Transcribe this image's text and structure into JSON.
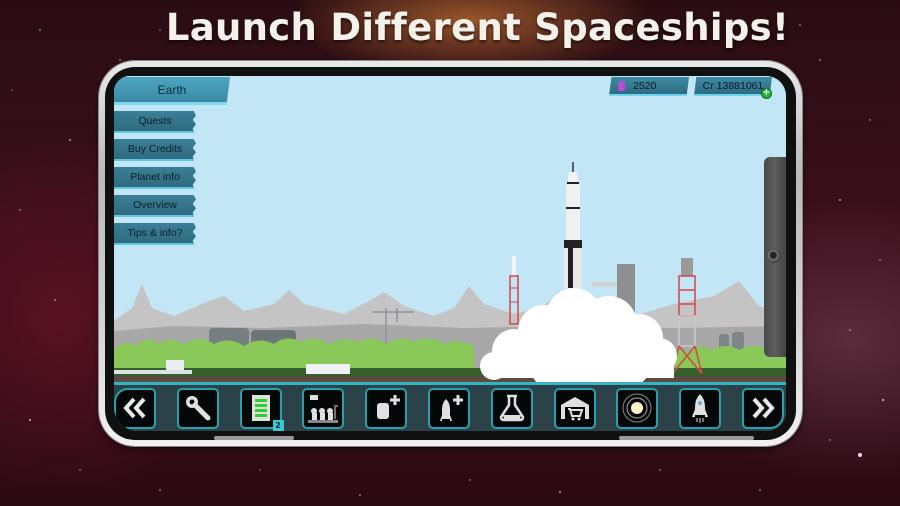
{
  "headline": "Launch Different Spaceships!",
  "game": {
    "planet_tab": "Earth",
    "menu": [
      {
        "label": "Quests"
      },
      {
        "label": "Buy Credits"
      },
      {
        "label": "Planet info"
      },
      {
        "label": "Overview"
      },
      {
        "label": "Tips & info?"
      }
    ],
    "currency": {
      "gems": "2520",
      "credits": "Cr 13881061",
      "add_icon": "plus-icon"
    },
    "toolbar": [
      {
        "name": "scroll-left-button",
        "icon": "double-chevron-left-icon"
      },
      {
        "name": "build-button",
        "icon": "wrench-icon"
      },
      {
        "name": "missions-button",
        "icon": "checklist-icon",
        "badge": "2"
      },
      {
        "name": "crew-button",
        "icon": "astronauts-icon"
      },
      {
        "name": "add-module-button",
        "icon": "module-plus-icon"
      },
      {
        "name": "add-rocket-button",
        "icon": "rocket-plus-icon"
      },
      {
        "name": "research-button",
        "icon": "flask-icon"
      },
      {
        "name": "hangar-shop-button",
        "icon": "hangar-cart-icon"
      },
      {
        "name": "solar-system-button",
        "icon": "orbit-icon"
      },
      {
        "name": "launch-button",
        "icon": "rocket-launch-icon"
      },
      {
        "name": "scroll-right-button",
        "icon": "double-chevron-right-icon"
      }
    ]
  },
  "colors": {
    "sky": "#c3e6f6",
    "toolbar_accent": "#33b6c1",
    "menu_button": "#3b7f96",
    "gem": "#b44fd0",
    "add_badge": "#26b43a"
  }
}
